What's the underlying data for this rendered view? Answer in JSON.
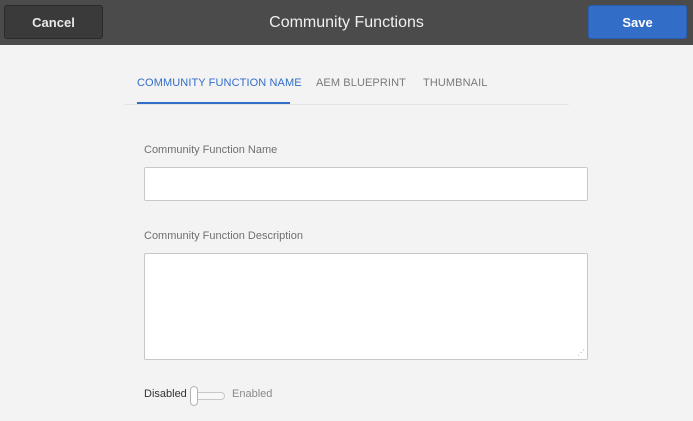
{
  "header": {
    "title": "Community Functions",
    "cancel_label": "Cancel",
    "save_label": "Save"
  },
  "tabs": [
    {
      "label": "COMMUNITY FUNCTION NAME",
      "active": true
    },
    {
      "label": "AEM BLUEPRINT",
      "active": false
    },
    {
      "label": "THUMBNAIL",
      "active": false
    }
  ],
  "form": {
    "name_label": "Community Function Name",
    "name_value": "",
    "description_label": "Community Function Description",
    "description_value": "",
    "toggle": {
      "off_label": "Disabled",
      "on_label": "Enabled",
      "state": "Disabled"
    }
  },
  "colors": {
    "accent": "#326ec8",
    "header_bg": "#4b4b4b",
    "page_bg": "#f3f3f3"
  }
}
